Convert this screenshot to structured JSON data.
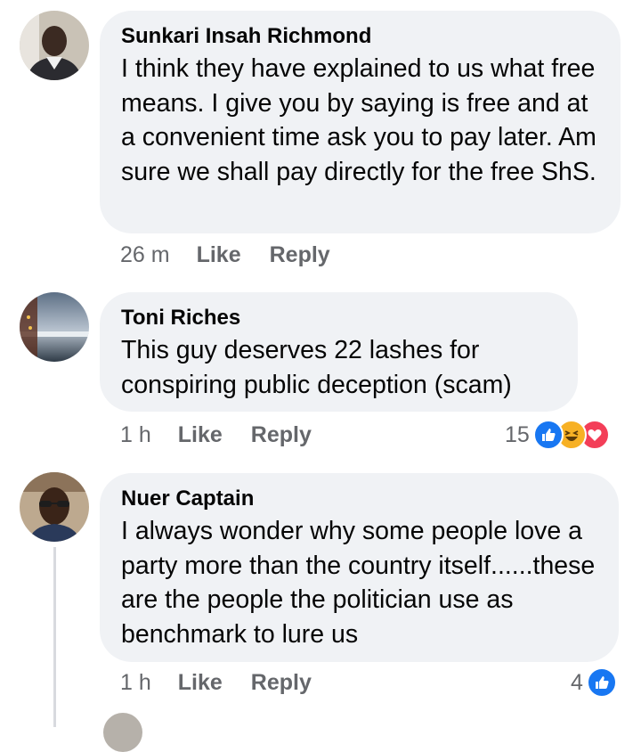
{
  "comments": [
    {
      "author": "Sunkari Insah Richmond",
      "text": "I think they have explained to us what free means. I give you by saying is free and at a convenient time ask you to pay later. Am sure we shall pay directly for the free ShS.",
      "time": "26 m",
      "like_label": "Like",
      "reply_label": "Reply",
      "reaction_count": ""
    },
    {
      "author": "Toni Riches",
      "text": "This guy deserves 22 lashes for conspiring public deception (scam)",
      "time": "1 h",
      "like_label": "Like",
      "reply_label": "Reply",
      "reaction_count": "15",
      "reactions": [
        "like-icon",
        "haha-icon",
        "love-icon"
      ]
    },
    {
      "author": "Nuer Captain",
      "text": "I always wonder why some people love a party more than the country itself......these are the people the politician use as benchmark to lure us",
      "time": "1 h",
      "like_label": "Like",
      "reply_label": "Reply",
      "reaction_count": "4",
      "reactions": [
        "like-icon"
      ]
    }
  ],
  "colors": {
    "bubble": "#f0f2f5",
    "meta_text": "#65676b",
    "like_blue": "#1877f2",
    "love_red": "#f33e58",
    "haha_yellow": "#f7b125"
  }
}
